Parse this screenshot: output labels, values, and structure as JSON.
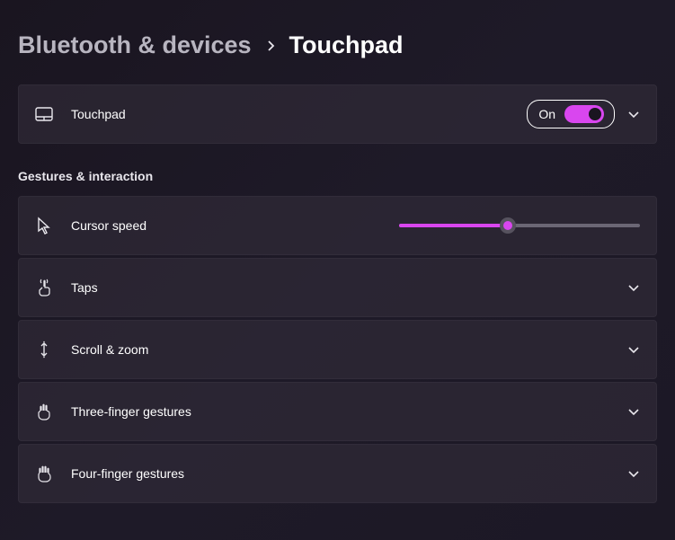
{
  "breadcrumb": {
    "parent": "Bluetooth & devices",
    "current": "Touchpad"
  },
  "touchpad": {
    "label": "Touchpad",
    "toggle_state": "On"
  },
  "section_title": "Gestures & interaction",
  "items": {
    "cursor_speed": {
      "label": "Cursor speed",
      "value_percent": 45
    },
    "taps": {
      "label": "Taps"
    },
    "scroll_zoom": {
      "label": "Scroll & zoom"
    },
    "three_finger": {
      "label": "Three-finger gestures"
    },
    "four_finger": {
      "label": "Four-finger gestures"
    }
  },
  "colors": {
    "accent": "#d946ef"
  }
}
